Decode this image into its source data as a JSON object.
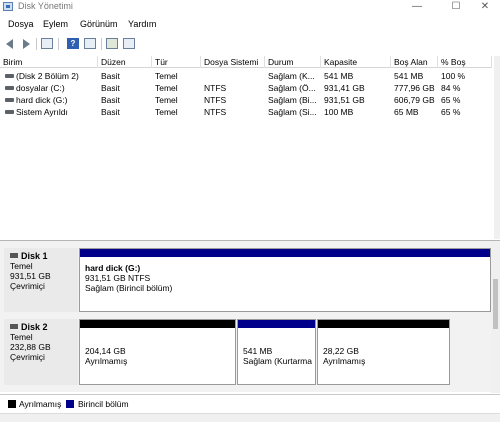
{
  "window": {
    "title": "Disk Yönetimi",
    "min": "—",
    "max": "☐",
    "close": "✕"
  },
  "menu": [
    "Dosya",
    "Eylem",
    "Görünüm",
    "Yardım"
  ],
  "toolbar": {
    "help_label": "?"
  },
  "volume_list": {
    "columns": [
      "Birim",
      "Düzen",
      "Tür",
      "Dosya Sistemi",
      "Durum",
      "Kapasite",
      "Boş Alan",
      "% Boş"
    ],
    "rows": [
      [
        "(Disk 2 Bölüm 2)",
        "Basit",
        "Temel",
        "",
        "Sağlam (K...",
        "541 MB",
        "541 MB",
        "100 %"
      ],
      [
        "dosyalar (C:)",
        "Basit",
        "Temel",
        "NTFS",
        "Sağlam (Ö...",
        "931,41 GB",
        "777,96 GB",
        "84 %"
      ],
      [
        "hard dick (G:)",
        "Basit",
        "Temel",
        "NTFS",
        "Sağlam (Bi...",
        "931,51 GB",
        "606,79 GB",
        "65 %"
      ],
      [
        "Sistem Ayrıldı",
        "Basit",
        "Temel",
        "NTFS",
        "Sağlam (Si...",
        "100 MB",
        "65 MB",
        "65 %"
      ]
    ]
  },
  "disks": [
    {
      "name": "Disk 1",
      "type": "Temel",
      "size": "931,51 GB",
      "status": "Çevrimiçi",
      "partitions": [
        {
          "name": "hard dick  (G:)",
          "size": "931,51 GB NTFS",
          "status": "Sağlam (Birincil bölüm)",
          "kind": "primary"
        }
      ]
    },
    {
      "name": "Disk 2",
      "type": "Temel",
      "size": "232,88 GB",
      "status": "Çevrimiçi",
      "partitions": [
        {
          "size": "204,14 GB",
          "status": "Ayrılmamış",
          "kind": "unallocated"
        },
        {
          "size": "541 MB",
          "status": "Sağlam (Kurtarma",
          "kind": "primary"
        },
        {
          "size": "28,22 GB",
          "status": "Ayrılmamış",
          "kind": "unallocated"
        }
      ]
    }
  ],
  "legend": [
    {
      "label": "Ayrılmamış",
      "color": "#000000"
    },
    {
      "label": "Birincil bölüm",
      "color": "#00008b"
    }
  ],
  "colors": {
    "primary": "#00008b",
    "unallocated": "#000000"
  }
}
